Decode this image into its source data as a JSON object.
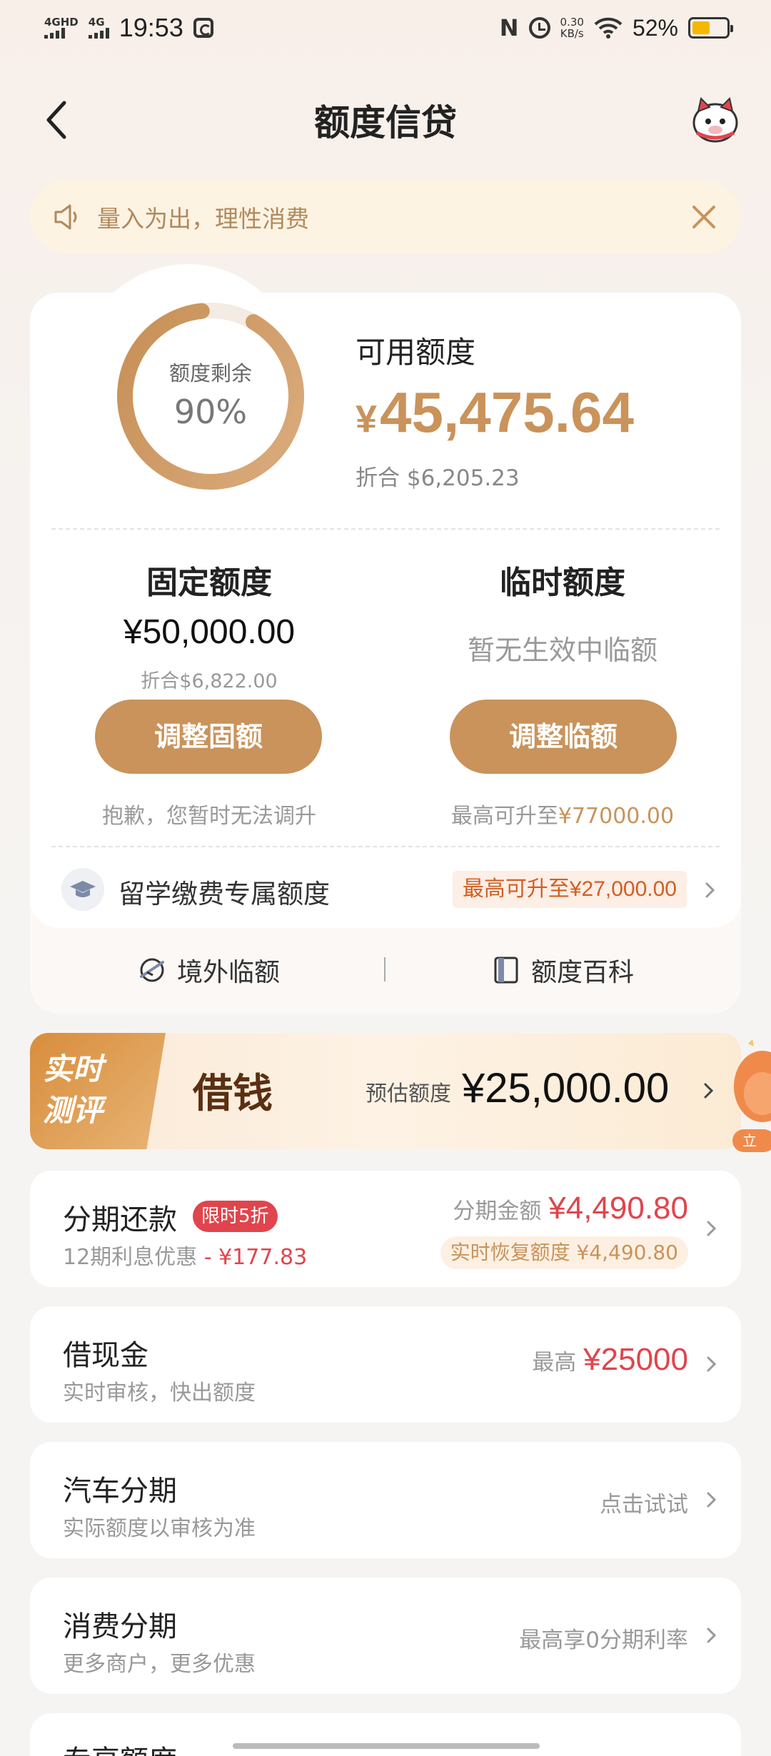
{
  "status_bar": {
    "sim1": "4GHD",
    "sim2": "4G",
    "time": "19:53",
    "nfc": "N",
    "speed_value": "0.30",
    "speed_unit": "KB/s",
    "battery": "52%",
    "battery_level": 0.52
  },
  "header": {
    "title": "额度信贷",
    "back_icon": "chevron-left-icon",
    "avatar_icon": "mascot-avatar-icon"
  },
  "notice": {
    "text": "量入为出，理性消费"
  },
  "quota": {
    "ring_label": "额度剩余",
    "ring_percent": "90%",
    "ring_fraction": 0.9,
    "available_title": "可用额度",
    "available_currency": "¥",
    "available_amount": "45,475.64",
    "available_equiv": "折合  $6,205.23",
    "fixed": {
      "title": "固定额度",
      "amount": "¥50,000.00",
      "equiv": "折合$6,822.00",
      "button": "调整固额",
      "note": "抱歉，您暂时无法调升"
    },
    "temp": {
      "title": "临时额度",
      "status": "暂无生效中临额",
      "button": "调整临额",
      "note_prefix": "最高可升至",
      "note_amount": "¥77000.00"
    },
    "study": {
      "label": "留学缴费专属额度",
      "tag": "最高可升至¥27,000.00"
    },
    "links": {
      "overseas": "境外临额",
      "wiki": "额度百科"
    }
  },
  "borrow": {
    "badge_line1": "实时",
    "badge_line2": "测评",
    "title": "借钱",
    "estimate_label": "预估额度",
    "estimate_amount": "¥25,000.00",
    "mascot_text": "立"
  },
  "installment": {
    "title": "分期还款",
    "badge": "限时5折",
    "sub_prefix": "12期利息优惠",
    "sub_discount": "- ¥177.83",
    "amount_label": "分期金额",
    "amount": "¥4,490.80",
    "recover_tag": "实时恢复额度 ¥4,490.80"
  },
  "cash": {
    "title": "借现金",
    "sub": "实时审核，快出额度",
    "label": "最高",
    "amount": "¥25000"
  },
  "car": {
    "title": "汽车分期",
    "sub": "实际额度以审核为准",
    "action": "点击试试"
  },
  "consume": {
    "title": "消费分期",
    "sub": "更多商户，更多优惠",
    "action": "最高享0分期利率"
  },
  "exclusive": {
    "title": "专享额度"
  },
  "colors": {
    "gold": "#c9935b",
    "red": "#e0454d",
    "notice_bg": "#fdf3e2"
  }
}
